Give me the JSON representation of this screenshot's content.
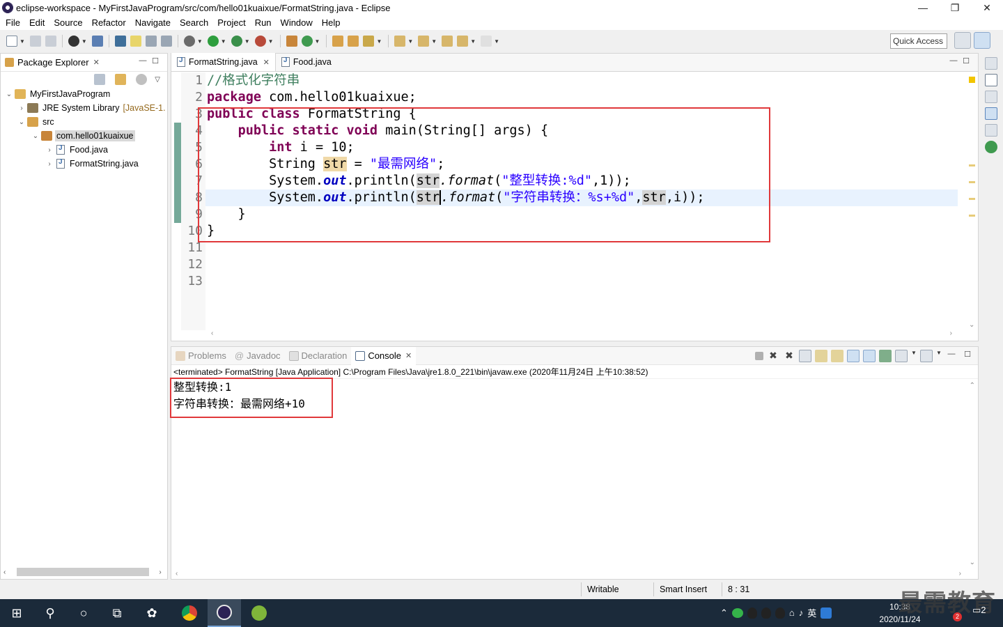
{
  "window": {
    "title": "eclipse-workspace - MyFirstJavaProgram/src/com/hello01kuaixue/FormatString.java - Eclipse",
    "minimize": "—",
    "maximize": "❐",
    "close": "✕"
  },
  "menu": [
    "File",
    "Edit",
    "Source",
    "Refactor",
    "Navigate",
    "Search",
    "Project",
    "Run",
    "Window",
    "Help"
  ],
  "toolbar": {
    "quick_access": "Quick Access"
  },
  "package_explorer": {
    "title": "Package Explorer",
    "tree": [
      {
        "label": "MyFirstJavaProgram",
        "depth": 0,
        "arrow": "⌄",
        "icon": "project-icon"
      },
      {
        "label": "JRE System Library",
        "decor": "[JavaSE-1.",
        "depth": 1,
        "arrow": "›",
        "icon": "library-icon"
      },
      {
        "label": "src",
        "depth": 1,
        "arrow": "⌄",
        "icon": "source-folder-icon"
      },
      {
        "label": "com.hello01kuaixue",
        "depth": 2,
        "arrow": "⌄",
        "icon": "package-icon",
        "selected": true
      },
      {
        "label": "Food.java",
        "depth": 3,
        "arrow": "›",
        "icon": "java-file-icon"
      },
      {
        "label": "FormatString.java",
        "depth": 3,
        "arrow": "›",
        "icon": "java-file-icon"
      }
    ]
  },
  "editor": {
    "tabs": [
      {
        "label": "FormatString.java",
        "active": true
      },
      {
        "label": "Food.java",
        "active": false
      }
    ],
    "line_numbers": [
      "1",
      "2",
      "3",
      "4",
      "5",
      "6",
      "7",
      "8",
      "9",
      "10",
      "11",
      "12",
      "13"
    ],
    "code": {
      "l1_comment": "//格式化字符串",
      "l2_kw": "package",
      "l2_rest": " com.hello01kuaixue;",
      "l3_kw1": "public",
      "l3_kw2": "class",
      "l3_rest": " FormatString {",
      "l4_indent": "    ",
      "l4_kw1": "public",
      "l4_kw2": "static",
      "l4_kw3": "void",
      "l4_rest": " main(String[] args) {",
      "l5_indent": "        ",
      "l5_kw": "int",
      "l5_rest": " i = 10;",
      "l6_pre": "        String ",
      "l6_var": "str",
      "l6_mid": " = ",
      "l6_str": "\"最需网络\"",
      "l6_end": ";",
      "l7_pre": "        System.",
      "l7_out": "out",
      "l7_mid": ".println(",
      "l7_var": "str",
      "l7_fmt": ".format",
      "l7_open": "(",
      "l7_str": "\"整型转换:%d\"",
      "l7_end": ",1));",
      "l8_pre": "        System.",
      "l8_out": "out",
      "l8_mid": ".println(",
      "l8_var": "str",
      "l8_fmt": ".format",
      "l8_open": "(",
      "l8_str": "\"字符串转换：%s+%d\"",
      "l8_comma": ",",
      "l8_var2": "str",
      "l8_end": ",i));",
      "l9": "    }",
      "l10": "}"
    }
  },
  "console": {
    "tabs": [
      {
        "label": "Problems",
        "active": false,
        "icon": "problems-icon"
      },
      {
        "label": "Javadoc",
        "active": false,
        "icon": "javadoc-icon"
      },
      {
        "label": "Declaration",
        "active": false,
        "icon": "declaration-icon"
      },
      {
        "label": "Console",
        "active": true,
        "icon": "console-icon"
      }
    ],
    "status": "<terminated> FormatString [Java Application] C:\\Program Files\\Java\\jre1.8.0_221\\bin\\javaw.exe (2020年11月24日 上午10:38:52)",
    "output": [
      "整型转换:1",
      "字符串转换：最需网络+10"
    ]
  },
  "statusbar": {
    "writable": "Writable",
    "insert_mode": "Smart Insert",
    "position": "8 : 31"
  },
  "taskbar": {
    "ime": "英",
    "time": "10:38",
    "date": "2020/11/24",
    "badge": "2",
    "notif_count": "2"
  },
  "watermark": "最需教育",
  "colors": {
    "highlight_box": "#e0383a",
    "keyword": "#7f0055",
    "string": "#2a00ff",
    "comment": "#3f7f5f",
    "field": "#0000c0"
  }
}
